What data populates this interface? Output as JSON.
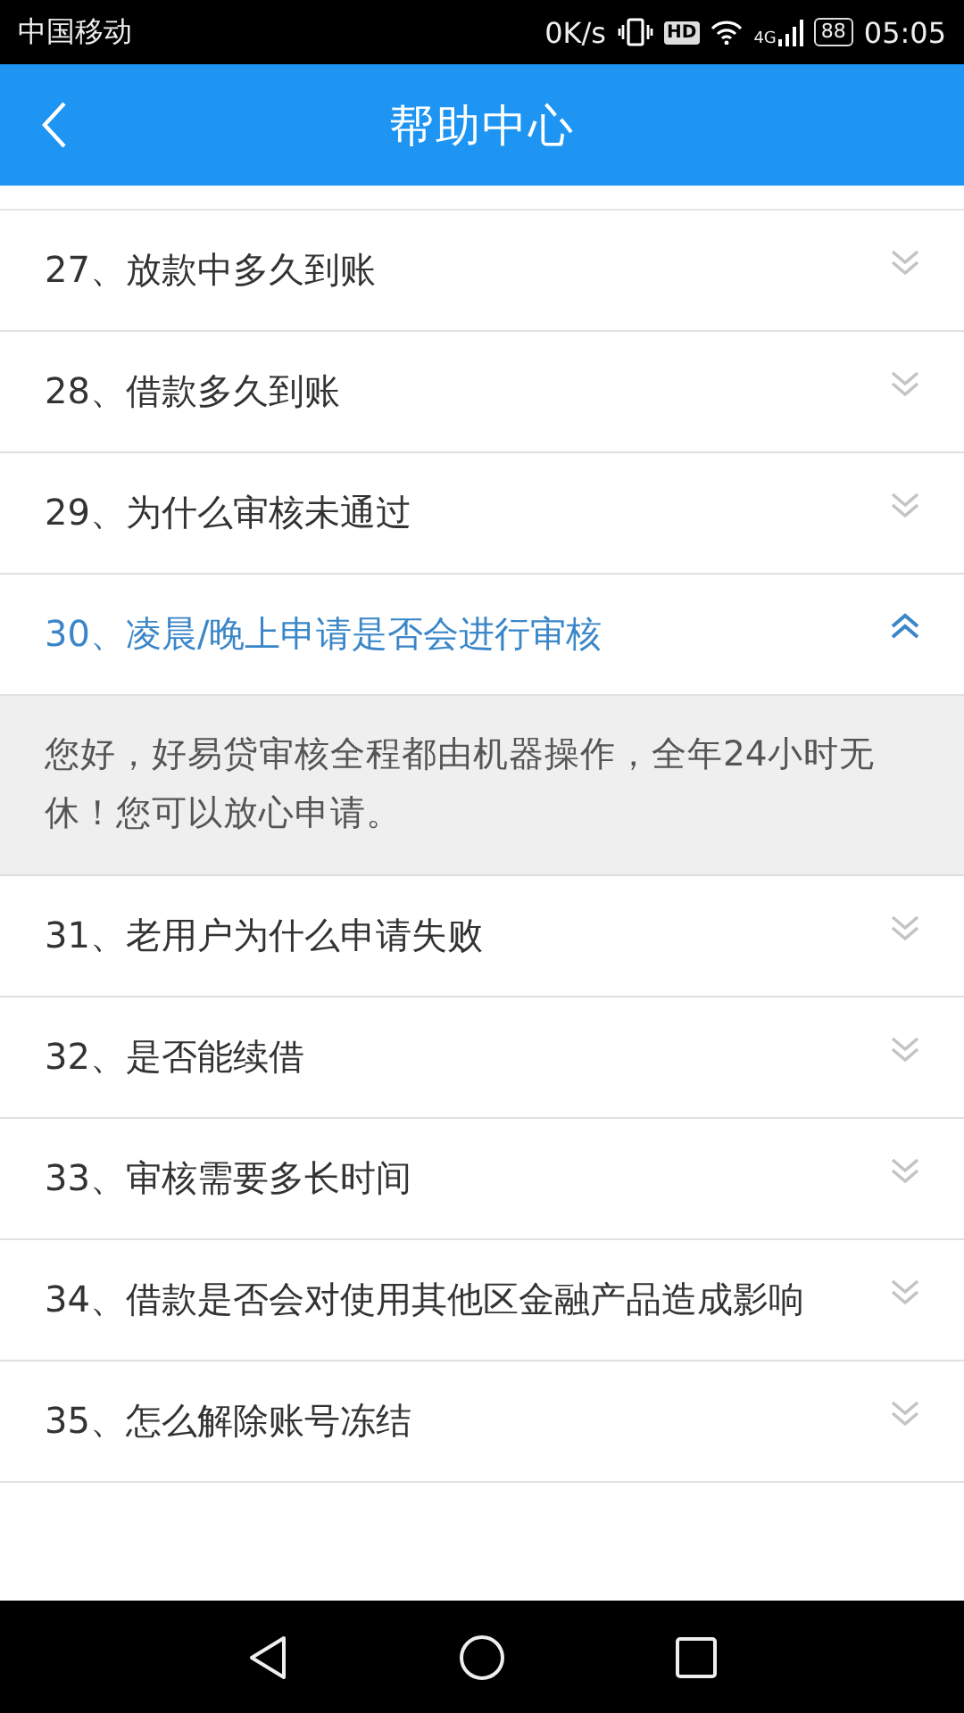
{
  "status_bar": {
    "carrier": "中国移动",
    "speed": "0K/s",
    "hd": "HD",
    "network": "4G",
    "battery": "88",
    "time": "05:05"
  },
  "header": {
    "title": "帮助中心"
  },
  "faq": [
    {
      "question": "27、放款中多久到账",
      "expanded": false
    },
    {
      "question": "28、借款多久到账",
      "expanded": false
    },
    {
      "question": "29、为什么审核未通过",
      "expanded": false
    },
    {
      "question": "30、凌晨/晚上申请是否会进行审核",
      "expanded": true,
      "answer": "您好，好易贷审核全程都由机器操作，全年24小时无休！您可以放心申请。"
    },
    {
      "question": "31、老用户为什么申请失败",
      "expanded": false
    },
    {
      "question": "32、是否能续借",
      "expanded": false
    },
    {
      "question": "33、审核需要多长时间",
      "expanded": false
    },
    {
      "question": "34、借款是否会对使用其他区金融产品造成影响",
      "expanded": false
    },
    {
      "question": "35、怎么解除账号冻结",
      "expanded": false
    }
  ]
}
